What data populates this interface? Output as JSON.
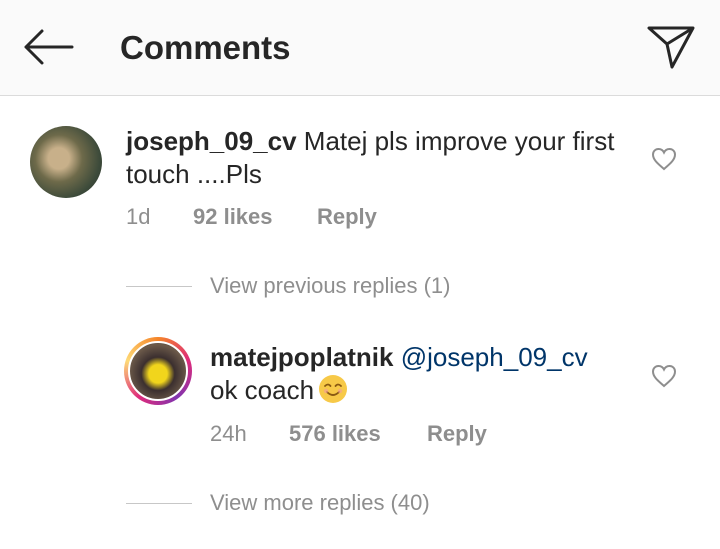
{
  "header": {
    "title": "Comments",
    "back_icon": "arrow-left-icon",
    "send_icon": "paper-plane-icon"
  },
  "comments": [
    {
      "username": "joseph_09_cv",
      "text": "Matej pls improve your first touch ....Pls",
      "time": "1d",
      "likes": "92 likes",
      "reply_label": "Reply",
      "heart_icon": "heart-outline-icon"
    }
  ],
  "threads": {
    "view_previous": "View previous replies (1)",
    "view_more": "View more replies (40)"
  },
  "replies": [
    {
      "username": "matejpoplatnik",
      "mention": "@joseph_09_cv",
      "text": "ok coach",
      "emoji": "smiling-face-icon",
      "time": "24h",
      "likes": "576 likes",
      "reply_label": "Reply",
      "heart_icon": "heart-outline-icon"
    }
  ],
  "colors": {
    "text": "#262626",
    "meta": "#8e8e8e",
    "mention": "#003569",
    "header_bg": "#fafafa",
    "divider": "#dbdbdb"
  }
}
